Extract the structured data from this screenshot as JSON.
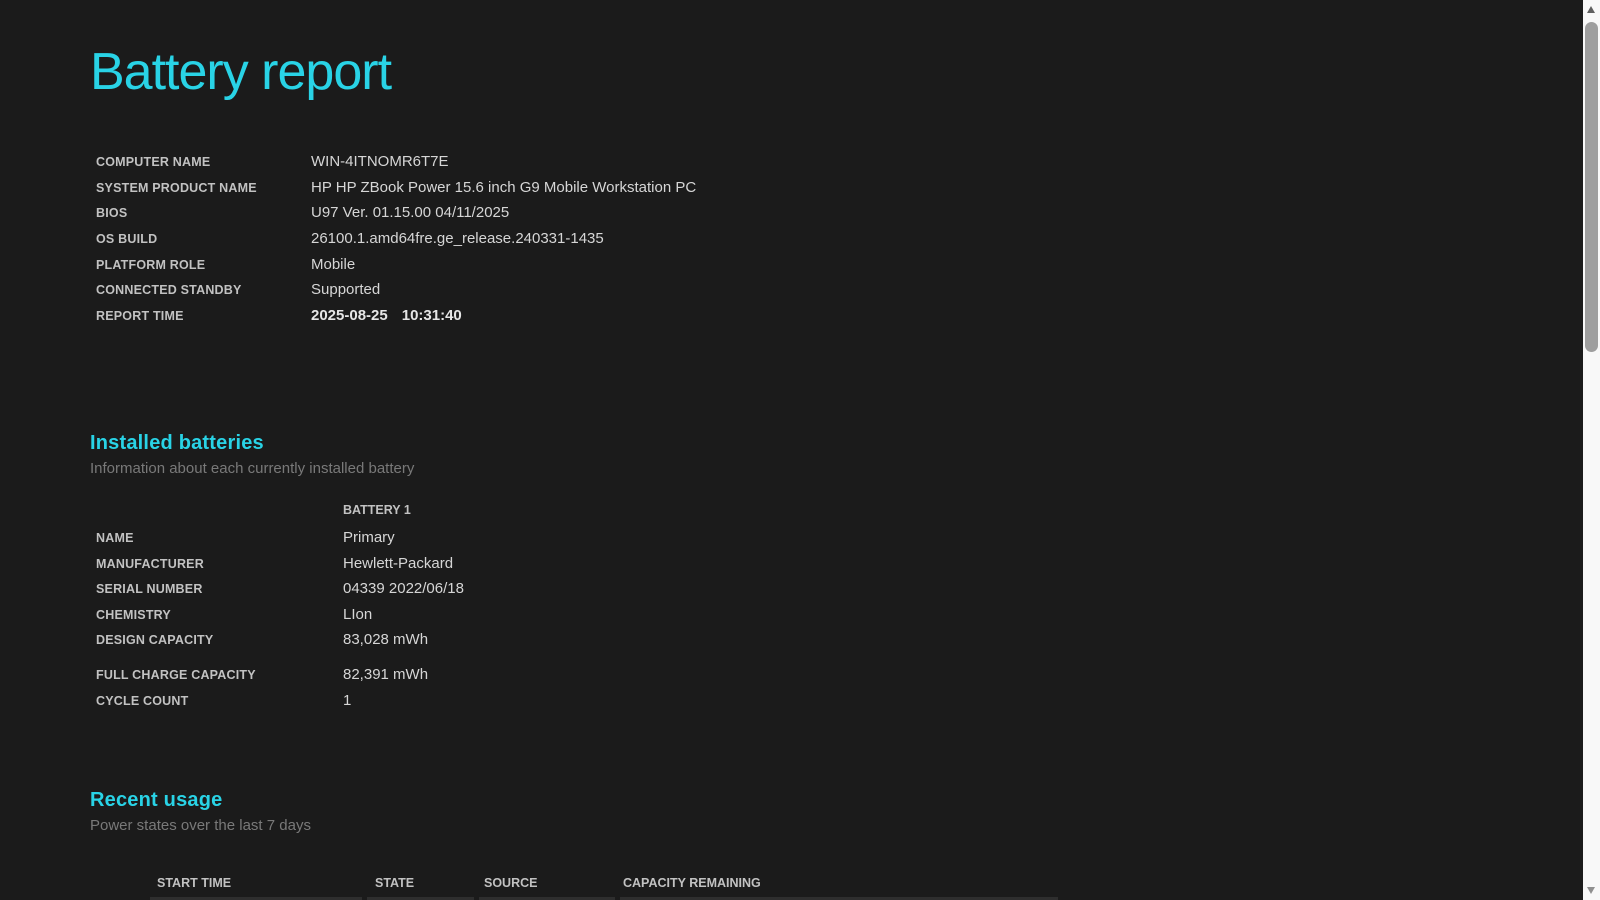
{
  "accent_color": "#29d3e6",
  "page": {
    "title": "Battery report"
  },
  "system_info": {
    "rows": [
      {
        "label": "COMPUTER NAME",
        "value": "WIN-4ITNOMR6T7E"
      },
      {
        "label": "SYSTEM PRODUCT NAME",
        "value": "HP HP ZBook Power 15.6 inch G9 Mobile Workstation PC"
      },
      {
        "label": "BIOS",
        "value": "U97 Ver. 01.15.00 04/11/2025"
      },
      {
        "label": "OS BUILD",
        "value": "26100.1.amd64fre.ge_release.240331-1435"
      },
      {
        "label": "PLATFORM ROLE",
        "value": "Mobile"
      },
      {
        "label": "CONNECTED STANDBY",
        "value": "Supported"
      },
      {
        "label": "REPORT TIME",
        "date": "2025-08-25",
        "time": "10:31:40"
      }
    ]
  },
  "installed_batteries": {
    "heading": "Installed batteries",
    "subtitle": "Information about each currently installed battery",
    "column_header": "BATTERY 1",
    "rows": [
      {
        "label": "NAME",
        "value": "Primary"
      },
      {
        "label": "MANUFACTURER",
        "value": "Hewlett-Packard"
      },
      {
        "label": "SERIAL NUMBER",
        "value": "04339 2022/06/18"
      },
      {
        "label": "CHEMISTRY",
        "value": "LIon"
      },
      {
        "label": "DESIGN CAPACITY",
        "value": "83,028 mWh"
      },
      {
        "label": "FULL CHARGE CAPACITY",
        "value": "82,391 mWh"
      },
      {
        "label": "CYCLE COUNT",
        "value": "1"
      }
    ]
  },
  "recent_usage": {
    "heading": "Recent usage",
    "subtitle": "Power states over the last 7 days",
    "columns": [
      "START TIME",
      "STATE",
      "SOURCE",
      "CAPACITY REMAINING"
    ]
  }
}
